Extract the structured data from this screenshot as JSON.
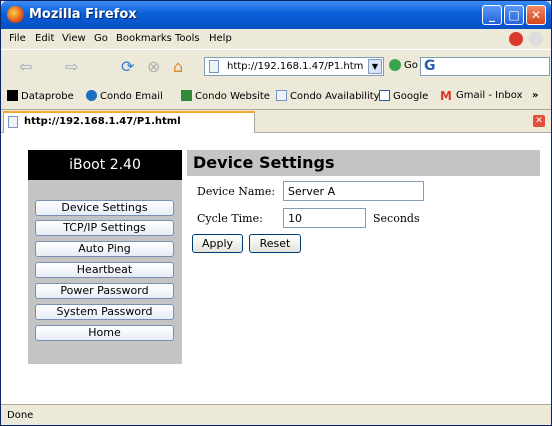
{
  "window": {
    "title": "Mozilla Firefox"
  },
  "menu": {
    "items": [
      "File",
      "Edit",
      "View",
      "Go",
      "Bookmarks",
      "Tools",
      "Help"
    ]
  },
  "nav": {
    "url": "http://192.168.1.47/P1.htm",
    "go_label": "Go",
    "search_icon": "G"
  },
  "bookmarks": [
    {
      "label": "Dataprobe",
      "icon": "dataprobe-icon"
    },
    {
      "label": "Condo Email",
      "icon": "condo-email-icon"
    },
    {
      "label": "Condo Website",
      "icon": "condo-website-icon"
    },
    {
      "label": "Condo Availability",
      "icon": "page-icon"
    },
    {
      "label": "Google",
      "icon": "google-icon"
    },
    {
      "label": "Gmail - Inbox",
      "icon": "gmail-icon"
    }
  ],
  "overflow": "»",
  "tab": {
    "label": "http://192.168.1.47/P1.html"
  },
  "sidebar": {
    "brand": "iBoot 2.40",
    "items": [
      "Device Settings",
      "TCP/IP Settings",
      "Auto Ping",
      "Heartbeat",
      "Power Password",
      "System Password",
      "Home"
    ]
  },
  "page": {
    "title": "Device Settings",
    "device_name_label": "Device Name:",
    "device_name_value": "Server A",
    "cycle_time_label": "Cycle Time:",
    "cycle_time_value": "10",
    "cycle_time_unit": "Seconds",
    "apply_label": "Apply",
    "reset_label": "Reset"
  },
  "status": {
    "text": "Done"
  },
  "colors": {
    "titlebar": "#0a5fd8",
    "sidebar_bg": "#c4c4c4",
    "brand_bg": "#000000",
    "tab_accent": "#f4a82c"
  }
}
